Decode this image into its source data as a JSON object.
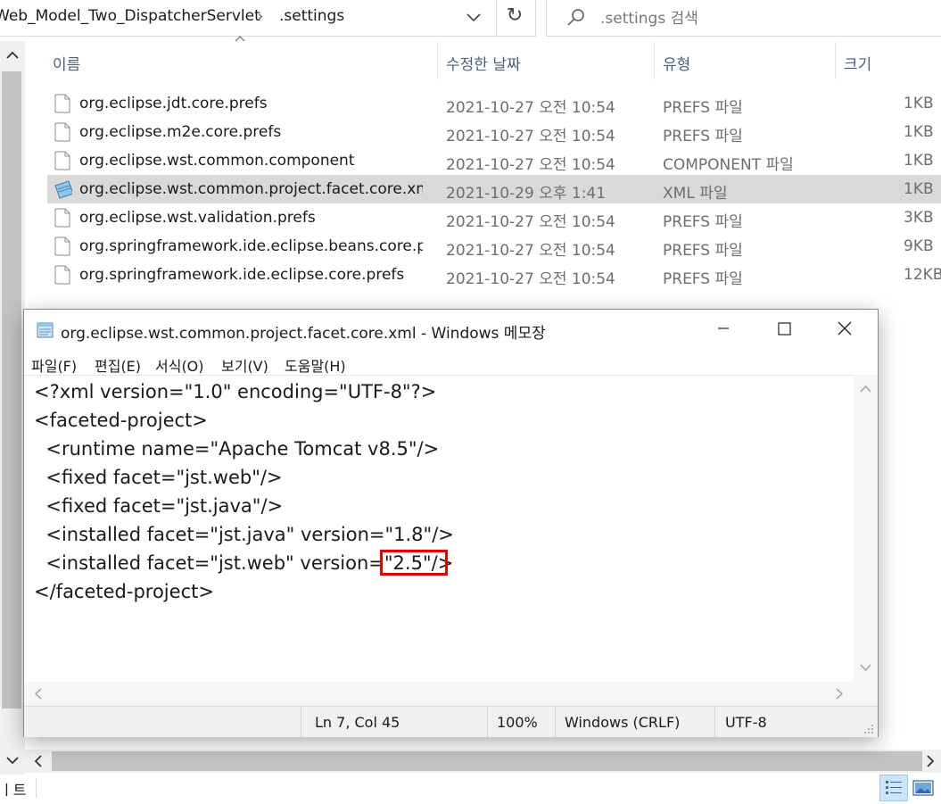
{
  "address_bar": {
    "path": "Web_Model_Two_DispatcherServlet",
    "separator": "›",
    "folder": ".settings",
    "refresh_icon": "↻"
  },
  "search": {
    "placeholder": ".settings 검색"
  },
  "columns": {
    "name": "이름",
    "modified": "수정한 날짜",
    "type": "유형",
    "size": "크기"
  },
  "files": [
    {
      "name": "org.eclipse.jdt.core.prefs",
      "date": "2021-10-27 오전 10:54",
      "type": "PREFS 파일",
      "size": "1KB",
      "icon": "file-icon"
    },
    {
      "name": "org.eclipse.m2e.core.prefs",
      "date": "2021-10-27 오전 10:54",
      "type": "PREFS 파일",
      "size": "1KB",
      "icon": "file-icon"
    },
    {
      "name": "org.eclipse.wst.common.component",
      "date": "2021-10-27 오전 10:54",
      "type": "COMPONENT 파일",
      "size": "1KB",
      "icon": "file-icon"
    },
    {
      "name": "org.eclipse.wst.common.project.facet.core.xml",
      "date": "2021-10-29 오후 1:41",
      "type": "XML 파일",
      "size": "1KB",
      "icon": "notepad-file-icon",
      "selected": true
    },
    {
      "name": "org.eclipse.wst.validation.prefs",
      "date": "2021-10-27 오전 10:54",
      "type": "PREFS 파일",
      "size": "3KB",
      "icon": "file-icon"
    },
    {
      "name": "org.springframework.ide.eclipse.beans.core.pr...",
      "date": "2021-10-27 오전 10:54",
      "type": "PREFS 파일",
      "size": "9KB",
      "icon": "file-icon"
    },
    {
      "name": "org.springframework.ide.eclipse.core.prefs",
      "date": "2021-10-27 오전 10:54",
      "type": "PREFS 파일",
      "size": "12KB",
      "icon": "file-icon"
    }
  ],
  "explorer_status": {
    "left_text": "ㅣ트"
  },
  "notepad": {
    "title": "org.eclipse.wst.common.project.facet.core.xml - Windows 메모장",
    "menu": [
      "파일(F)",
      "편집(E)",
      "서식(O)",
      "보기(V)",
      "도움말(H)"
    ],
    "lines": [
      "<?xml version=\"1.0\" encoding=\"UTF-8\"?>",
      "<faceted-project>",
      "  <runtime name=\"Apache Tomcat v8.5\"/>",
      "  <fixed facet=\"jst.web\"/>",
      "  <fixed facet=\"jst.java\"/>",
      "  <installed facet=\"jst.java\" version=\"1.8\"/>",
      "  <installed facet=\"jst.web\" version=\"2.5\"/>",
      "</faceted-project>"
    ],
    "highlighted_text": "\"2.5\"/>",
    "status": {
      "position": "Ln 7, Col 45",
      "zoom": "100%",
      "line_ending": "Windows (CRLF)",
      "encoding": "UTF-8"
    },
    "highlight_color": "#e00000"
  }
}
